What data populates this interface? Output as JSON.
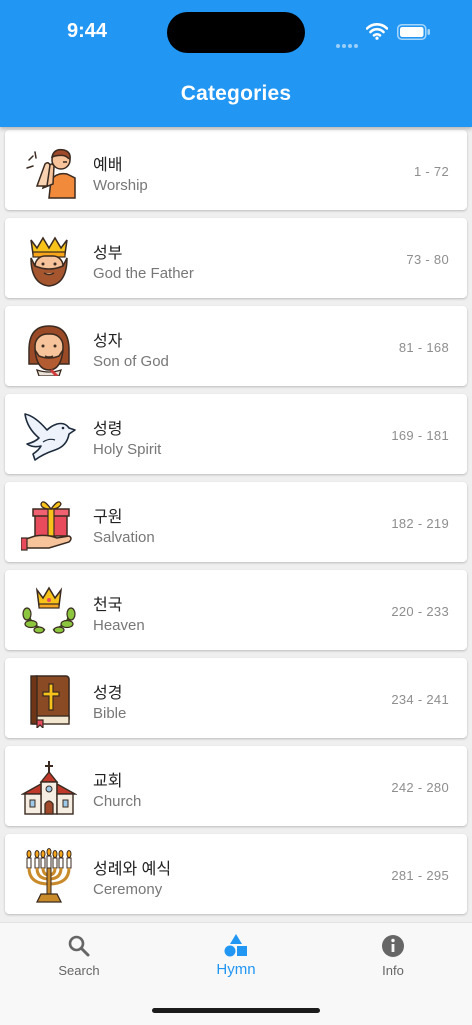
{
  "status_bar": {
    "time": "9:44"
  },
  "header": {
    "title": "Categories"
  },
  "categories": [
    {
      "ko": "예배",
      "en": "Worship",
      "range": "1 - 72",
      "icon": "praying-man-icon"
    },
    {
      "ko": "성부",
      "en": "God the Father",
      "range": "73 - 80",
      "icon": "crowned-king-icon"
    },
    {
      "ko": "성자",
      "en": "Son of God",
      "range": "81 - 168",
      "icon": "jesus-face-icon"
    },
    {
      "ko": "성령",
      "en": "Holy Spirit",
      "range": "169 - 181",
      "icon": "dove-icon"
    },
    {
      "ko": "구원",
      "en": "Salvation",
      "range": "182 - 219",
      "icon": "gift-in-hand-icon"
    },
    {
      "ko": "천국",
      "en": "Heaven",
      "range": "220 - 233",
      "icon": "crown-laurel-icon"
    },
    {
      "ko": "성경",
      "en": "Bible",
      "range": "234 - 241",
      "icon": "bible-book-icon"
    },
    {
      "ko": "교회",
      "en": "Church",
      "range": "242 - 280",
      "icon": "church-building-icon"
    },
    {
      "ko": "성례와 예식",
      "en": "Ceremony",
      "range": "281 - 295",
      "icon": "menorah-icon"
    }
  ],
  "tabs": [
    {
      "label": "Search",
      "icon": "search-icon"
    },
    {
      "label": "Hymn",
      "icon": "shapes-icon"
    },
    {
      "label": "Info",
      "icon": "info-icon"
    }
  ],
  "colors": {
    "primary": "#2196f3",
    "background": "#efefef",
    "card": "#ffffff"
  }
}
